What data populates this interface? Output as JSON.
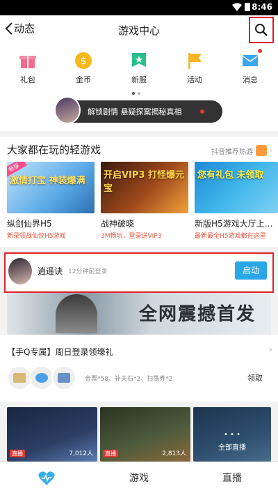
{
  "status_bar": {
    "time": "8:46"
  },
  "header": {
    "back_label": "动态",
    "title": "游戏中心"
  },
  "quick_links": [
    {
      "label": "礼包",
      "icon": "gift-icon",
      "color": "#f36b8c"
    },
    {
      "label": "金币",
      "icon": "coin-icon",
      "color": "#f5b91c",
      "glyph": "$"
    },
    {
      "label": "新服",
      "icon": "new-server-icon",
      "color": "#28c08a"
    },
    {
      "label": "活动",
      "icon": "flag-icon",
      "color": "#f6b524"
    },
    {
      "label": "消息",
      "icon": "message-icon",
      "color": "#3aa7ec"
    }
  ],
  "promo_pill": {
    "text": "解锁剧情 悬疑探案揭秘真相"
  },
  "featured": {
    "title": "大家都在玩的轻游戏",
    "source": "抖音推荐热游",
    "games": [
      {
        "name": "纵剑仙界H5",
        "subtitle": "新录领战仙侠H5游戏",
        "art_text": "激情打宝 神装爆满",
        "tag": "新版",
        "color": "#5aa9e6"
      },
      {
        "name": "战神破晓",
        "subtitle": "3M畅玩，登录送VIP3",
        "art_text": "开启VIP3 打怪爆元宝",
        "tag": "",
        "color": "#7a3b1e"
      },
      {
        "name": "新版H5游戏大厅上…",
        "subtitle": "最新最全H5游戏都在这里",
        "art_text": "您有礼包 未领取",
        "tag": "",
        "color": "#3fb6ea"
      }
    ]
  },
  "recent_game": {
    "name": "逍遥诀",
    "last_login": "12分钟前登录",
    "button": "启动"
  },
  "banner": {
    "text": "全网震撼首发"
  },
  "gift": {
    "title": "【手Q专属】周日登录领壕礼",
    "desc": "金票*58、补天石*2、扫荡券*2",
    "claim": "领取"
  },
  "live": [
    {
      "badge": "直播",
      "count": "7,012人",
      "color": "#2c3e64"
    },
    {
      "badge": "直播",
      "count": "2,813人",
      "color": "#4c5a3c"
    },
    {
      "all_label": "全部直播",
      "color": "#2e4f6e"
    }
  ],
  "tabbar": {
    "game": "游戏",
    "live": "直播"
  }
}
